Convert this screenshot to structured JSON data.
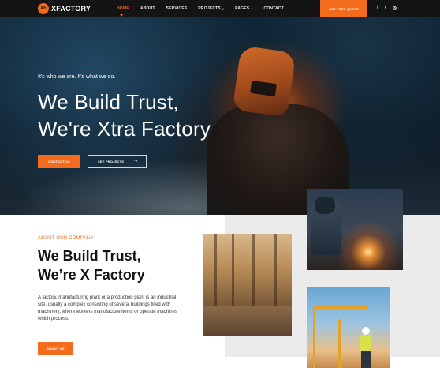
{
  "nav": {
    "logo_mark": "XF",
    "logo_text": "XFACTORY",
    "items": [
      {
        "label": "HOME",
        "active": true,
        "has_dropdown": false
      },
      {
        "label": "ABOUT",
        "active": false,
        "has_dropdown": false
      },
      {
        "label": "SERVICES",
        "active": false,
        "has_dropdown": false
      },
      {
        "label": "PROJECTS",
        "active": false,
        "has_dropdown": true
      },
      {
        "label": "PAGES",
        "active": false,
        "has_dropdown": true
      },
      {
        "label": "CONTACT",
        "active": false,
        "has_dropdown": false
      }
    ],
    "caret": "▾",
    "quote_button": "GET FREE QUOTE",
    "social": {
      "facebook": "f",
      "twitter": "t",
      "instagram": "◎"
    }
  },
  "hero": {
    "tagline": "It's who we are. It's what we do.",
    "title_line1": "We Build Trust,",
    "title_line2": "We're Xtra Factory",
    "contact_button": "CONTACT US",
    "projects_button": "SEE PROJECTS",
    "projects_arrow": "→"
  },
  "about": {
    "eyebrow": "ABOUT OUR COMPANY",
    "title_line1": "We Build Trust,",
    "title_line2": "We’re X Factory",
    "text": "A factory, manufacturing plant or a production plant is an industrial site, usually a complex consisting of several buildings filled with machinery, where workers manufacture items or operate machines which process.",
    "button": "ABOUT US"
  },
  "colors": {
    "accent": "#f36b1c",
    "nav_bg": "#141414",
    "heading": "#141414",
    "panel_gray": "#ebebeb"
  },
  "icons": [
    "logo-icon",
    "dropdown-caret-icon",
    "facebook-icon",
    "twitter-icon",
    "instagram-icon",
    "arrow-right-icon"
  ]
}
